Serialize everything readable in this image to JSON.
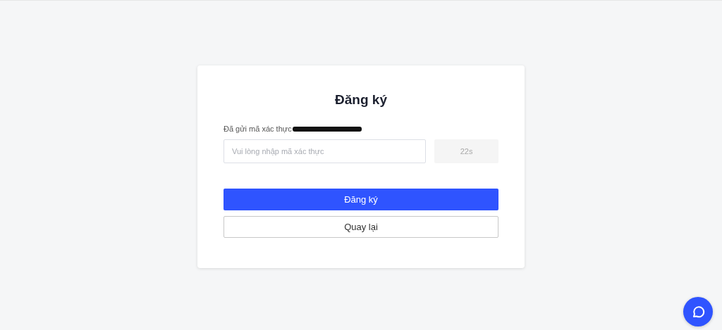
{
  "form": {
    "title": "Đăng ký",
    "sent_message": "Đã gửi mã xác thực",
    "recipient_redacted": true,
    "code_field": {
      "placeholder": "Vui lòng nhập mã xác thực"
    },
    "resend_button": {
      "label": "22s",
      "disabled": true
    },
    "submit_button": {
      "label": "Đăng ký"
    },
    "back_button": {
      "label": "Quay lại"
    }
  },
  "chat_button": {
    "kind": "chat"
  }
}
